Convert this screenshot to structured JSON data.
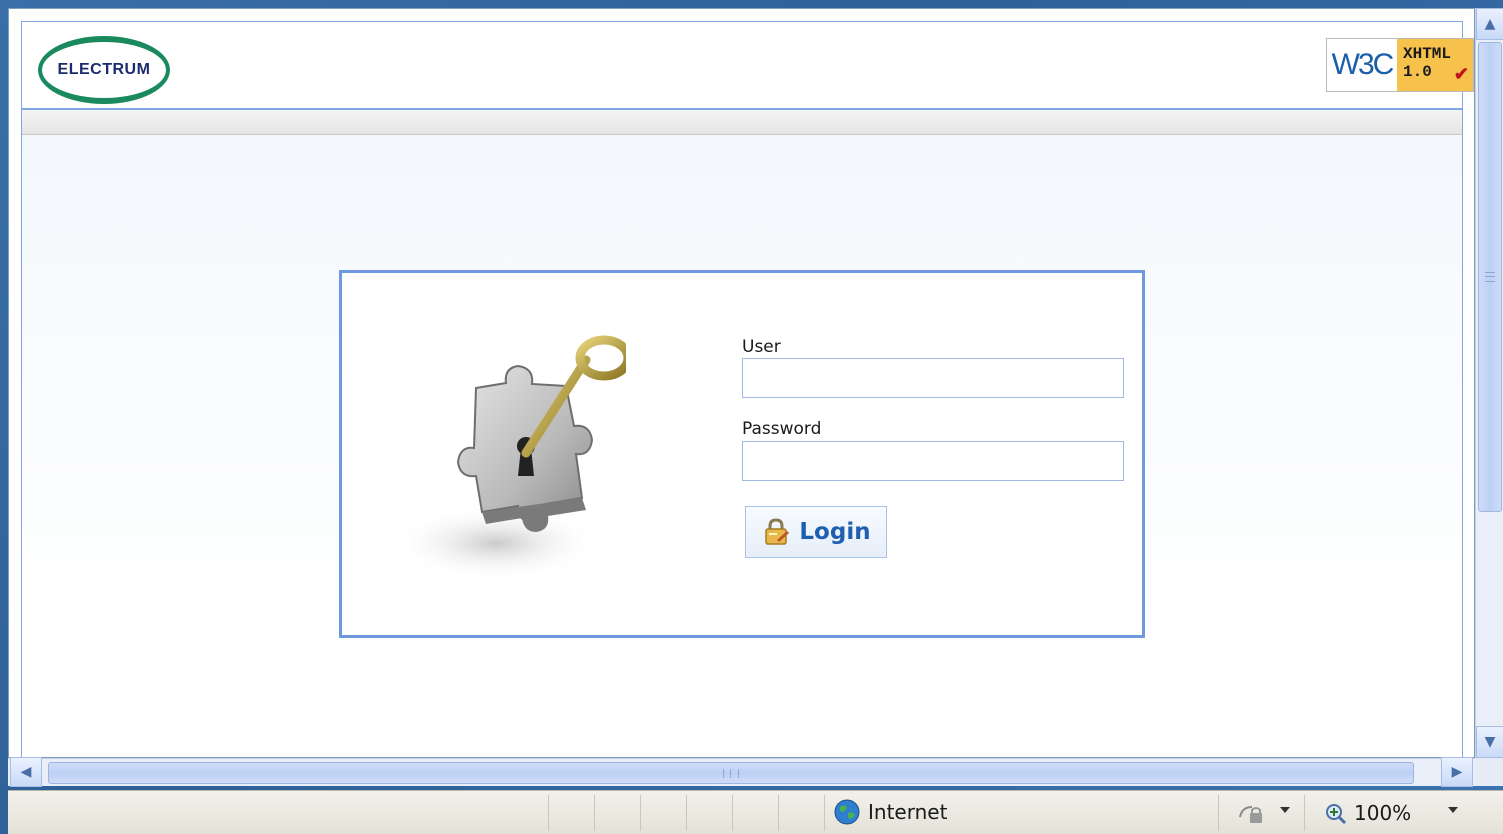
{
  "header": {
    "logo_text": "ELECTRUM",
    "badge": {
      "left": "W3C",
      "right_line1": "XHTML",
      "right_line2": "1.0"
    }
  },
  "login": {
    "user_label": "User",
    "user_value": "",
    "password_label": "Password",
    "password_value": "",
    "button_label": "Login"
  },
  "statusbar": {
    "zone_label": "Internet",
    "zoom_label": "100%"
  },
  "colors": {
    "accent_border": "#6f98e0",
    "button_text": "#1f5fb0",
    "logo_ring": "#1a8a5e",
    "badge_bg": "#f6c24c"
  },
  "icons": [
    "electrum-logo",
    "w3c-xhtml-badge",
    "key-puzzle-icon",
    "lock-icon",
    "globe-icon",
    "security-icon",
    "zoom-icon"
  ]
}
